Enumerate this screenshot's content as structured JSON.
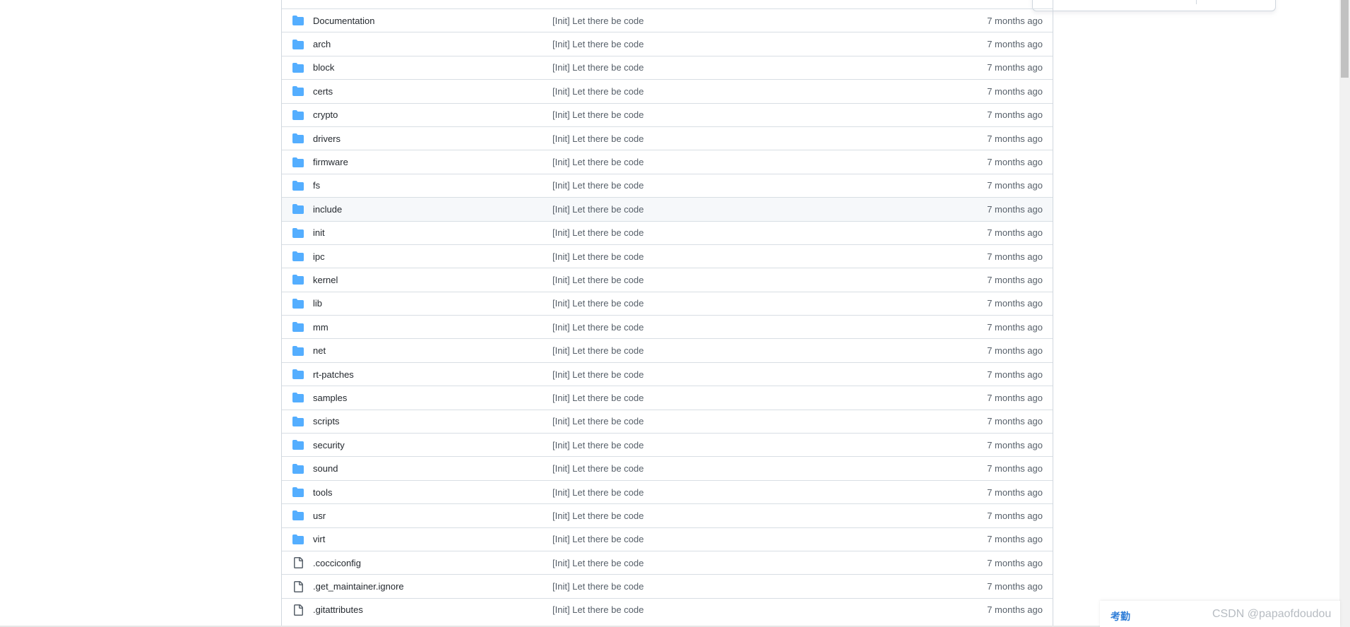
{
  "file_list": {
    "rows": [
      {
        "name": "Documentation",
        "type": "folder",
        "message": "[Init] Let there be code",
        "time": "7 months ago"
      },
      {
        "name": "arch",
        "type": "folder",
        "message": "[Init] Let there be code",
        "time": "7 months ago"
      },
      {
        "name": "block",
        "type": "folder",
        "message": "[Init] Let there be code",
        "time": "7 months ago"
      },
      {
        "name": "certs",
        "type": "folder",
        "message": "[Init] Let there be code",
        "time": "7 months ago"
      },
      {
        "name": "crypto",
        "type": "folder",
        "message": "[Init] Let there be code",
        "time": "7 months ago"
      },
      {
        "name": "drivers",
        "type": "folder",
        "message": "[Init] Let there be code",
        "time": "7 months ago"
      },
      {
        "name": "firmware",
        "type": "folder",
        "message": "[Init] Let there be code",
        "time": "7 months ago"
      },
      {
        "name": "fs",
        "type": "folder",
        "message": "[Init] Let there be code",
        "time": "7 months ago"
      },
      {
        "name": "include",
        "type": "folder",
        "message": "[Init] Let there be code",
        "time": "7 months ago"
      },
      {
        "name": "init",
        "type": "folder",
        "message": "[Init] Let there be code",
        "time": "7 months ago"
      },
      {
        "name": "ipc",
        "type": "folder",
        "message": "[Init] Let there be code",
        "time": "7 months ago"
      },
      {
        "name": "kernel",
        "type": "folder",
        "message": "[Init] Let there be code",
        "time": "7 months ago"
      },
      {
        "name": "lib",
        "type": "folder",
        "message": "[Init] Let there be code",
        "time": "7 months ago"
      },
      {
        "name": "mm",
        "type": "folder",
        "message": "[Init] Let there be code",
        "time": "7 months ago"
      },
      {
        "name": "net",
        "type": "folder",
        "message": "[Init] Let there be code",
        "time": "7 months ago"
      },
      {
        "name": "rt-patches",
        "type": "folder",
        "message": "[Init] Let there be code",
        "time": "7 months ago"
      },
      {
        "name": "samples",
        "type": "folder",
        "message": "[Init] Let there be code",
        "time": "7 months ago"
      },
      {
        "name": "scripts",
        "type": "folder",
        "message": "[Init] Let there be code",
        "time": "7 months ago"
      },
      {
        "name": "security",
        "type": "folder",
        "message": "[Init] Let there be code",
        "time": "7 months ago"
      },
      {
        "name": "sound",
        "type": "folder",
        "message": "[Init] Let there be code",
        "time": "7 months ago"
      },
      {
        "name": "tools",
        "type": "folder",
        "message": "[Init] Let there be code",
        "time": "7 months ago"
      },
      {
        "name": "usr",
        "type": "folder",
        "message": "[Init] Let there be code",
        "time": "7 months ago"
      },
      {
        "name": "virt",
        "type": "folder",
        "message": "[Init] Let there be code",
        "time": "7 months ago"
      },
      {
        "name": ".cocciconfig",
        "type": "file",
        "message": "[Init] Let there be code",
        "time": "7 months ago"
      },
      {
        "name": ".get_maintainer.ignore",
        "type": "file",
        "message": "[Init] Let there be code",
        "time": "7 months ago"
      },
      {
        "name": ".gitattributes",
        "type": "file",
        "message": "[Init] Let there be code",
        "time": "7 months ago"
      }
    ],
    "hovered_row": "include"
  },
  "colors": {
    "folder_icon": "#54aeff",
    "file_icon": "#57606a",
    "link_text": "#24292f",
    "muted_text": "#57606a",
    "border": "#d8dee4",
    "hover_bg": "#f6f8fa",
    "attendance_accent": "#2f7dd7"
  },
  "attendance_widget": {
    "label": "考勤"
  },
  "watermark": {
    "text": "CSDN @papaofdoudou"
  }
}
